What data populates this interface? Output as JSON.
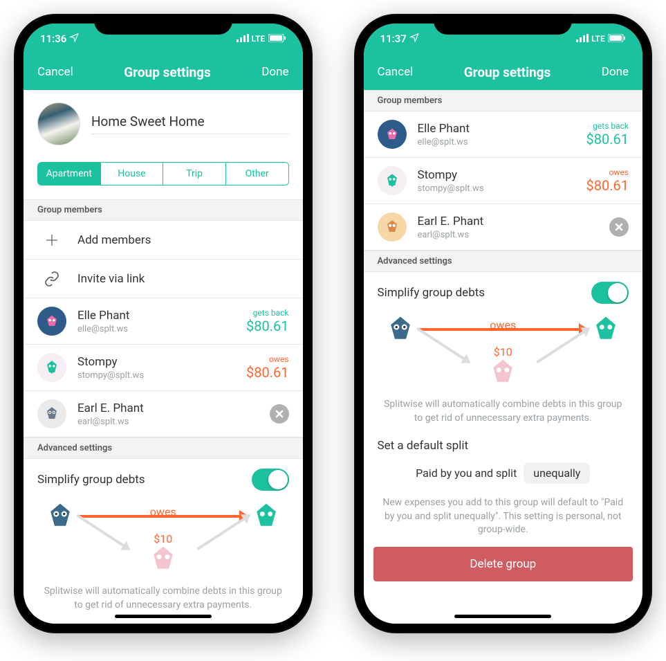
{
  "status": {
    "time1": "11:36",
    "time2": "11:37",
    "net": "LTE"
  },
  "nav": {
    "cancel": "Cancel",
    "title": "Group settings",
    "done": "Done"
  },
  "group": {
    "name": "Home Sweet Home"
  },
  "types": {
    "apartment": "Apartment",
    "house": "House",
    "trip": "Trip",
    "other": "Other",
    "selected": "apartment"
  },
  "sections": {
    "members": "Group members",
    "advanced": "Advanced settings"
  },
  "actions": {
    "add": "Add members",
    "invite": "Invite via link"
  },
  "members": [
    {
      "name": "Elle Phant",
      "email": "elle@splt.ws",
      "balance_label": "gets back",
      "balance_amount": "$80.61",
      "balance_type": "pos"
    },
    {
      "name": "Stompy",
      "email": "stompy@splt.ws",
      "balance_label": "owes",
      "balance_amount": "$80.61",
      "balance_type": "neg"
    },
    {
      "name": "Earl E. Phant",
      "email": "earl@splt.ws",
      "balance_label": "",
      "balance_amount": "",
      "balance_type": "none"
    }
  ],
  "simplify": {
    "title": "Simplify group debts",
    "owes_label": "owes",
    "owes_amount": "$10",
    "help": "Splitwise will automatically combine debts in this group to get rid of unnecessary extra payments."
  },
  "default_split": {
    "title": "Set a default split",
    "prefix": "Paid by you and split",
    "value": "unequally",
    "help": "New expenses you add to this group will default to \"Paid by you and split unequally\". This setting is personal, not group-wide."
  },
  "delete": "Delete group"
}
